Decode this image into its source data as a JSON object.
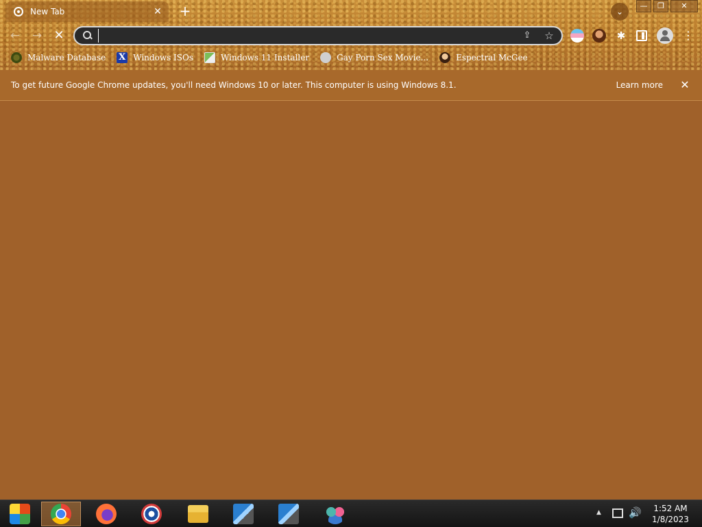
{
  "browser": {
    "tab": {
      "title": "New Tab",
      "close_label": "✕"
    },
    "new_tab_label": "+",
    "tab_search_label": "⌄",
    "window_controls": {
      "minimize": "—",
      "maximize": "❐",
      "close": "✕"
    }
  },
  "toolbar": {
    "back_label": "←",
    "forward_label": "→",
    "stop_label": "✕",
    "omnibox": {
      "value": "",
      "placeholder": ""
    },
    "share_label": "⇪",
    "star_label": "☆",
    "puzzle_label": "✱",
    "menu_label": "⋮"
  },
  "bookmarks": [
    {
      "label": "Malware Database",
      "icon": "malware-icon"
    },
    {
      "label": "Windows ISOs",
      "icon": "x-icon"
    },
    {
      "label": "Windows 11 Installer",
      "icon": "installer-icon"
    },
    {
      "label": "Gay Porn Sex Movie...",
      "icon": "site-icon"
    },
    {
      "label": "Espectral McGee",
      "icon": "avatar-icon"
    }
  ],
  "infobar": {
    "message": "To get future Google Chrome updates, you'll need Windows 10 or later. This computer is using Windows 8.1.",
    "learn_more": "Learn more",
    "close_label": "✕"
  },
  "taskbar": {
    "apps": [
      "start",
      "chrome",
      "firefox",
      "obama",
      "file-explorer",
      "installer",
      "installer",
      "people"
    ],
    "tray": {
      "arrow": "▲",
      "volume": "🔊"
    },
    "clock": {
      "time": "1:52 AM",
      "date": "1/8/2023"
    }
  },
  "colors": {
    "accent": "#a0612a",
    "infobar": "#a8692b",
    "taskbar": "#1a1a1a"
  }
}
